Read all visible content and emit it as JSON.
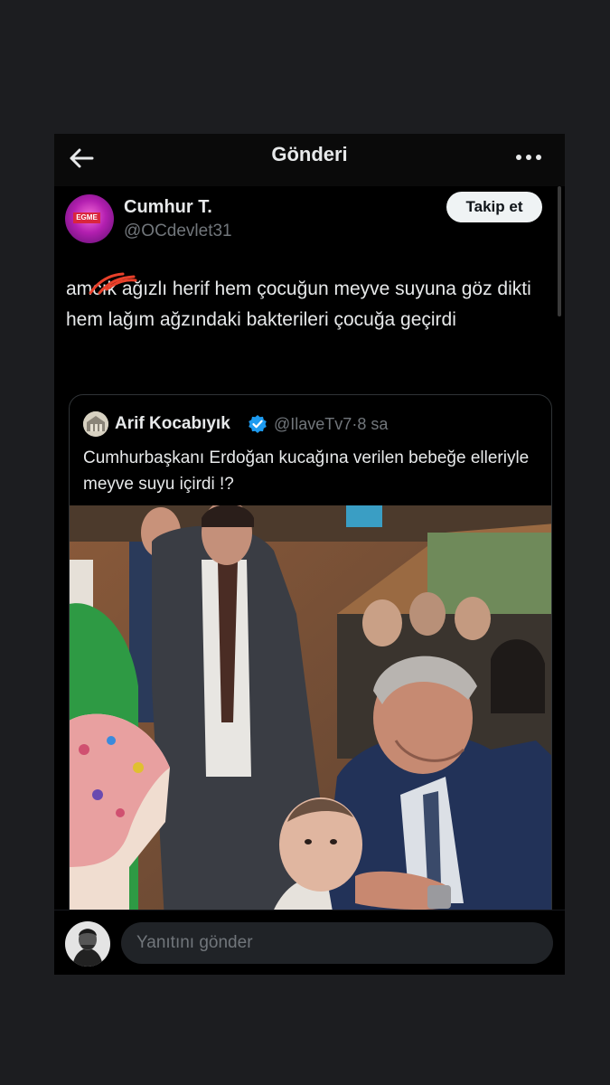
{
  "header": {
    "title": "Gönderi",
    "back_icon": "arrow-left-icon",
    "more_icon": "more-horizontal-icon"
  },
  "post": {
    "author_name": "Cumhur T.",
    "author_handle": "@OCdevlet31",
    "avatar_badge": "EGME",
    "follow_label": "Takip et",
    "text": "amcık ağızlı herif hem çocuğun meyve suyuna göz dikti hem lağım ağzındaki bakterileri çocuğa geçirdi"
  },
  "quote": {
    "author_name": "Arif Kocabıyık",
    "author_handle": "@IlaveTv7",
    "separator": "·",
    "time": "8 sa",
    "text": "Cumhurbaşkanı Erdoğan kucağına verilen bebeğe elleriyle meyve suyu içirdi !?",
    "verified": true
  },
  "reply": {
    "placeholder": "Yanıtını gönder"
  },
  "colors": {
    "background": "#1c1d20",
    "surface": "#000000",
    "text_primary": "#e7e9ea",
    "text_secondary": "#71767b",
    "verified_blue": "#1d9bf0",
    "follow_button_bg": "#eff3f4"
  }
}
